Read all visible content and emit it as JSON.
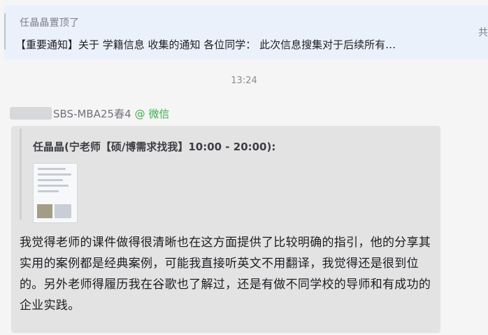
{
  "pinned": {
    "title": "任晶晶置顶了",
    "content": "【重要通知】关于 学籍信息 收集的通知  各位同学：  此次信息搜集对于后续所有…",
    "right_text": "共"
  },
  "timestamp": "13:24",
  "message": {
    "sender": "SBS-MBA25春4",
    "sender_app": "@ 微信",
    "quote_header": "任晶晶(宁老师【硕/博需求找我】10:00 - 20:00):",
    "body": "我觉得老师的课件做得很清晰也在这方面提供了比较明确的指引，他的分享其实用的案例都是经典案例，可能我直接听英文不用翻译，我觉得还是很到位的。另外老师得履历我在谷歌也了解过，还是有做不同学校的导师和有成功的企业实践。"
  },
  "colors": {
    "background": "#f5f5f6",
    "pinned_bg": "#eaf1fb",
    "bubble_bg": "#e3e3e4",
    "wechat_green": "#3fae49"
  }
}
